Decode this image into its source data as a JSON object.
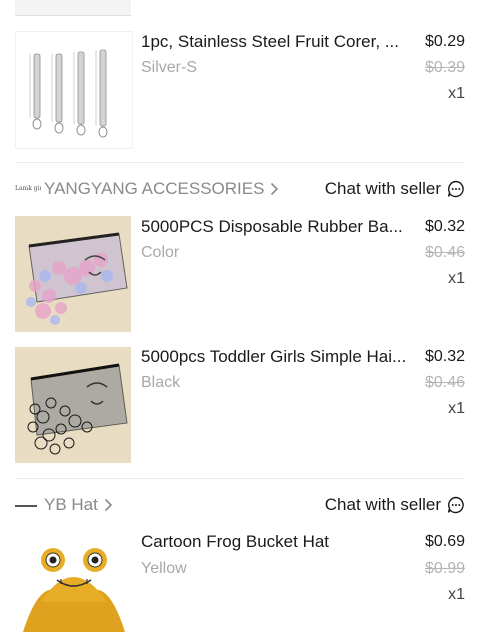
{
  "stores": [
    {
      "store_name": "",
      "items": [
        {
          "title": "1pc, Stainless Steel Fruit Corer, ...",
          "variant": "Silver-S",
          "price": "$0.29",
          "old_price": "$0.39",
          "qty": "x1"
        }
      ]
    },
    {
      "store_name": "YANGYANG ACCESSORIES",
      "logo_text": "Lamk girl",
      "chat_label": "Chat with seller",
      "items": [
        {
          "title": "5000PCS Disposable Rubber Ba...",
          "variant": "Color",
          "price": "$0.32",
          "old_price": "$0.46",
          "qty": "x1"
        },
        {
          "title": "5000pcs Toddler Girls Simple Hai...",
          "variant": "Black",
          "price": "$0.32",
          "old_price": "$0.46",
          "qty": "x1"
        }
      ]
    },
    {
      "store_name": "YB Hat",
      "chat_label": "Chat with seller",
      "items": [
        {
          "title": "Cartoon Frog Bucket Hat",
          "variant": "Yellow",
          "price": "$0.69",
          "old_price": "$0.99",
          "qty": "x1"
        }
      ]
    }
  ],
  "colors": {
    "text": "#1a1a1a",
    "muted": "#a8a8a8",
    "divider": "#ececec",
    "product_bg_beige": "#e8dcc3"
  }
}
